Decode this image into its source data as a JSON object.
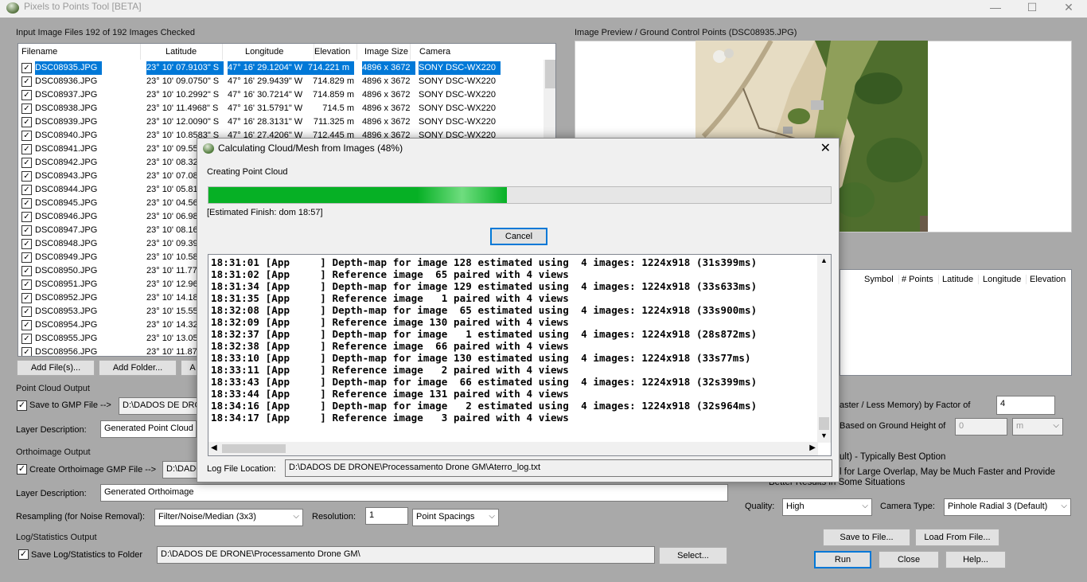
{
  "window": {
    "title": "Pixels to Points Tool [BETA]",
    "min": "—",
    "max": "☐",
    "close": "✕"
  },
  "input": {
    "group_title": "Input Image Files 192 of 192 Images Checked",
    "columns": [
      "Filename",
      "Latitude",
      "Longitude",
      "Elevation",
      "Image Size",
      "Camera"
    ],
    "rows": [
      {
        "f": "DSC08935.JPG",
        "lat": "23° 10' 07.9103\" S",
        "lon": "47° 16' 29.1204\" W",
        "el": "714.221 m",
        "sz": "4896 x 3672",
        "cam": "SONY DSC-WX220"
      },
      {
        "f": "DSC08936.JPG",
        "lat": "23° 10' 09.0750\" S",
        "lon": "47° 16' 29.9439\" W",
        "el": "714.829 m",
        "sz": "4896 x 3672",
        "cam": "SONY DSC-WX220"
      },
      {
        "f": "DSC08937.JPG",
        "lat": "23° 10' 10.2992\" S",
        "lon": "47° 16' 30.7214\" W",
        "el": "714.859 m",
        "sz": "4896 x 3672",
        "cam": "SONY DSC-WX220"
      },
      {
        "f": "DSC08938.JPG",
        "lat": "23° 10' 11.4968\" S",
        "lon": "47° 16' 31.5791\" W",
        "el": "714.5 m",
        "sz": "4896 x 3672",
        "cam": "SONY DSC-WX220"
      },
      {
        "f": "DSC08939.JPG",
        "lat": "23° 10' 12.0090\" S",
        "lon": "47° 16' 28.3131\" W",
        "el": "711.325 m",
        "sz": "4896 x 3672",
        "cam": "SONY DSC-WX220"
      },
      {
        "f": "DSC08940.JPG",
        "lat": "23° 10' 10.8583\" S",
        "lon": "47° 16' 27.4206\" W",
        "el": "712.445 m",
        "sz": "4896 x 3672",
        "cam": "SONY DSC-WX220"
      },
      {
        "f": "DSC08941.JPG",
        "lat": "23° 10' 09.55",
        "lon": "",
        "el": "",
        "sz": "",
        "cam": ""
      },
      {
        "f": "DSC08942.JPG",
        "lat": "23° 10' 08.32",
        "lon": "",
        "el": "",
        "sz": "",
        "cam": ""
      },
      {
        "f": "DSC08943.JPG",
        "lat": "23° 10' 07.08",
        "lon": "",
        "el": "",
        "sz": "",
        "cam": ""
      },
      {
        "f": "DSC08944.JPG",
        "lat": "23° 10' 05.81",
        "lon": "",
        "el": "",
        "sz": "",
        "cam": ""
      },
      {
        "f": "DSC08945.JPG",
        "lat": "23° 10' 04.56",
        "lon": "",
        "el": "",
        "sz": "",
        "cam": ""
      },
      {
        "f": "DSC08946.JPG",
        "lat": "23° 10' 06.98",
        "lon": "",
        "el": "",
        "sz": "",
        "cam": ""
      },
      {
        "f": "DSC08947.JPG",
        "lat": "23° 10' 08.16",
        "lon": "",
        "el": "",
        "sz": "",
        "cam": ""
      },
      {
        "f": "DSC08948.JPG",
        "lat": "23° 10' 09.39",
        "lon": "",
        "el": "",
        "sz": "",
        "cam": ""
      },
      {
        "f": "DSC08949.JPG",
        "lat": "23° 10' 10.58",
        "lon": "",
        "el": "",
        "sz": "",
        "cam": ""
      },
      {
        "f": "DSC08950.JPG",
        "lat": "23° 10' 11.77",
        "lon": "",
        "el": "",
        "sz": "",
        "cam": ""
      },
      {
        "f": "DSC08951.JPG",
        "lat": "23° 10' 12.96",
        "lon": "",
        "el": "",
        "sz": "",
        "cam": ""
      },
      {
        "f": "DSC08952.JPG",
        "lat": "23° 10' 14.18",
        "lon": "",
        "el": "",
        "sz": "",
        "cam": ""
      },
      {
        "f": "DSC08953.JPG",
        "lat": "23° 10' 15.55",
        "lon": "",
        "el": "",
        "sz": "",
        "cam": ""
      },
      {
        "f": "DSC08954.JPG",
        "lat": "23° 10' 14.32",
        "lon": "",
        "el": "",
        "sz": "",
        "cam": ""
      },
      {
        "f": "DSC08955.JPG",
        "lat": "23° 10' 13.05",
        "lon": "",
        "el": "",
        "sz": "",
        "cam": ""
      },
      {
        "f": "DSC08956.JPG",
        "lat": "23° 10' 11.87",
        "lon": "",
        "el": "",
        "sz": "",
        "cam": ""
      }
    ],
    "add_files": "Add File(s)...",
    "add_folder": "Add Folder...",
    "third_btn": "A"
  },
  "preview": {
    "title": "Image Preview / Ground Control Points (DSC08935.JPG)"
  },
  "gcp": {
    "columns": [
      "Symbol",
      "# Points",
      "Latitude",
      "Longitude",
      "Elevation"
    ]
  },
  "cloud": {
    "group_title": "Point Cloud Output",
    "save_label": "Save to GMP File -->",
    "path": "D:\\DADOS DE DRONE",
    "layer_label": "Layer Description:",
    "layer_value": "Generated Point Cloud"
  },
  "ortho": {
    "group_title": "Orthoimage Output",
    "create_label": "Create Orthoimage GMP File -->",
    "path": "D:\\DADOS DE",
    "layer_label": "Layer Description:",
    "layer_value": "Generated Orthoimage",
    "resampling_label": "Resampling (for Noise Removal):",
    "resampling_value": "Filter/Noise/Median (3x3)",
    "resolution_label": "Resolution:",
    "resolution_value": "1",
    "units_value": "Point Spacings"
  },
  "logstats": {
    "group_title": "Log/Statistics Output",
    "save_label": "Save Log/Statistics to Folder",
    "path": "D:\\DADOS DE DRONE\\Processamento Drone GM\\",
    "select": "Select..."
  },
  "right": {
    "factor_label": "aster / Less Memory) by Factor of",
    "factor_value": "4",
    "height_label": "Based on Ground Height of",
    "height_value": "0",
    "height_unit": "m",
    "opt1": "ult) - Typically Best Option",
    "opt2": "l for Large Overlap, May be Much Faster and Provide",
    "opt3": "Better Results in Some Situations",
    "quality_label": "Quality:",
    "quality_value": "High",
    "camera_label": "Camera Type:",
    "camera_value": "Pinhole Radial 3 (Default)",
    "save_file": "Save to File...",
    "load_file": "Load From File...",
    "run": "Run",
    "close": "Close",
    "help": "Help..."
  },
  "dialog": {
    "title": "Calculating Cloud/Mesh from Images (48%)",
    "close": "✕",
    "status": "Creating Point Cloud",
    "progress": 0.48,
    "estimate": "[Estimated Finish: dom 18:57]",
    "cancel": "Cancel",
    "log_lines": [
      "18:31:01 [App     ] Depth-map for image 128 estimated using  4 images: 1224x918 (31s399ms)",
      "18:31:02 [App     ] Reference image  65 paired with 4 views",
      "18:31:34 [App     ] Depth-map for image 129 estimated using  4 images: 1224x918 (33s633ms)",
      "18:31:35 [App     ] Reference image   1 paired with 4 views",
      "18:32:08 [App     ] Depth-map for image  65 estimated using  4 images: 1224x918 (33s900ms)",
      "18:32:09 [App     ] Reference image 130 paired with 4 views",
      "18:32:37 [App     ] Depth-map for image   1 estimated using  4 images: 1224x918 (28s872ms)",
      "18:32:38 [App     ] Reference image  66 paired with 4 views",
      "18:33:10 [App     ] Depth-map for image 130 estimated using  4 images: 1224x918 (33s77ms)",
      "18:33:11 [App     ] Reference image   2 paired with 4 views",
      "18:33:43 [App     ] Depth-map for image  66 estimated using  4 images: 1224x918 (32s399ms)",
      "18:33:44 [App     ] Reference image 131 paired with 4 views",
      "18:34:16 [App     ] Depth-map for image   2 estimated using  4 images: 1224x918 (32s964ms)",
      "18:34:17 [App     ] Reference image   3 paired with 4 views"
    ],
    "log_location_label": "Log File Location:",
    "log_location_value": "D:\\DADOS DE DRONE\\Processamento Drone GM\\Aterro_log.txt"
  }
}
